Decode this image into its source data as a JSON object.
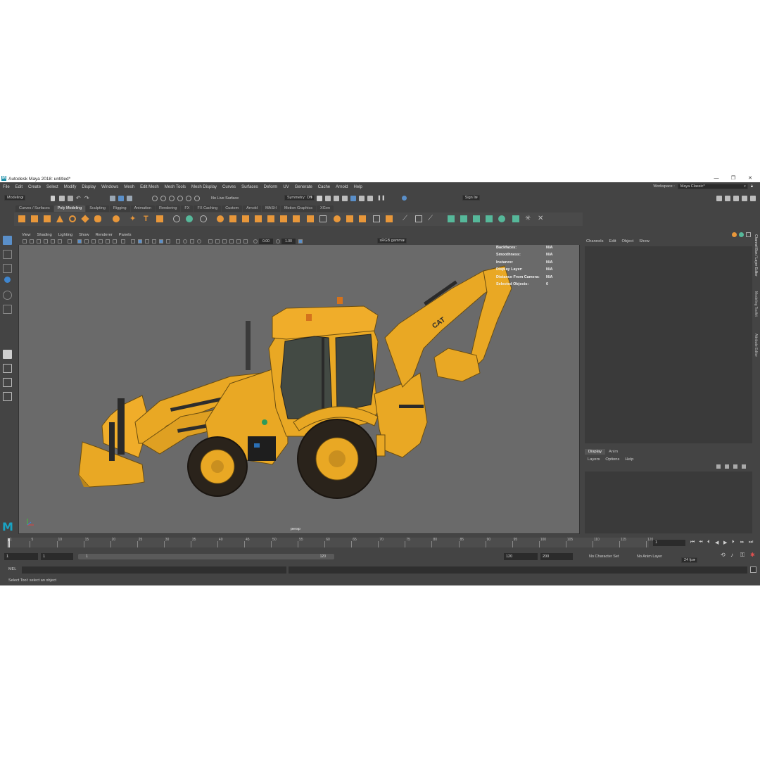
{
  "window": {
    "title": "Autodesk Maya 2018: untitled*",
    "logo": "M"
  },
  "window_buttons": {
    "minimize": "—",
    "maximize": "❐",
    "close": "✕"
  },
  "menu": [
    "File",
    "Edit",
    "Create",
    "Select",
    "Modify",
    "Display",
    "Windows",
    "Mesh",
    "Edit Mesh",
    "Mesh Tools",
    "Mesh Display",
    "Curves",
    "Surfaces",
    "Deform",
    "UV",
    "Generate",
    "Cache",
    "Arnold",
    "Help"
  ],
  "workspace": {
    "label": "Workspace :",
    "value": "Maya Classic*"
  },
  "status_line": {
    "mode": "Modeling",
    "live_surface": "No Live Surface",
    "symmetry": "Symmetry: Off",
    "sign_in": "Sign In"
  },
  "shelf_tabs": [
    "Curves / Surfaces",
    "Poly Modeling",
    "Sculpting",
    "Rigging",
    "Animation",
    "Rendering",
    "FX",
    "FX Caching",
    "Custom",
    "Arnold",
    "MASH",
    "Motion Graphics",
    "XGen"
  ],
  "shelf_active": "Poly Modeling",
  "viewport": {
    "menu": [
      "View",
      "Shading",
      "Lighting",
      "Show",
      "Renderer",
      "Panels"
    ],
    "exposure": "0.00",
    "gamma": "1.00",
    "color_space": "sRGB gamma",
    "camera": "persp",
    "hud": [
      {
        "label": "Backfaces:",
        "value": "N/A"
      },
      {
        "label": "Smoothness:",
        "value": "N/A"
      },
      {
        "label": "Instance:",
        "value": "N/A"
      },
      {
        "label": "Display Layer:",
        "value": "N/A"
      },
      {
        "label": "Distance From Camera:",
        "value": "N/A"
      },
      {
        "label": "Selected Objects:",
        "value": "0"
      }
    ],
    "model_text": "CAT"
  },
  "channel_box": {
    "menu": [
      "Channels",
      "Edit",
      "Object",
      "Show"
    ]
  },
  "layer_editor": {
    "tabs": [
      "Display",
      "Anim"
    ],
    "menu": [
      "Layers",
      "Options",
      "Help"
    ]
  },
  "side_tabs": [
    "Channel Box / Layer Editor",
    "Modeling Toolkit",
    "Attribute Editor"
  ],
  "timeline": {
    "ticks": [
      "1",
      "5",
      "10",
      "15",
      "20",
      "25",
      "30",
      "35",
      "40",
      "45",
      "50",
      "55",
      "60",
      "65",
      "70",
      "75",
      "80",
      "85",
      "90",
      "95",
      "100",
      "105",
      "110",
      "115",
      "120"
    ],
    "current_frame": "1"
  },
  "range": {
    "start": "1",
    "playback_start": "1",
    "slider_lo": "1",
    "slider_hi": "120",
    "playback_end": "120",
    "end": "200",
    "character_set": "No Character Set",
    "anim_layer": "No Anim Layer",
    "fps": "24 fps"
  },
  "command_line": {
    "lang": "MEL",
    "help": "Select Tool: select an object"
  },
  "colors": {
    "app_bg": "#444444",
    "viewport_bg": "#6a6a6a",
    "shelf_orange": "#e8973a",
    "shelf_teal": "#56b89a",
    "accent_blue": "#5a8fc9",
    "excavator_yellow": "#e9a824"
  }
}
